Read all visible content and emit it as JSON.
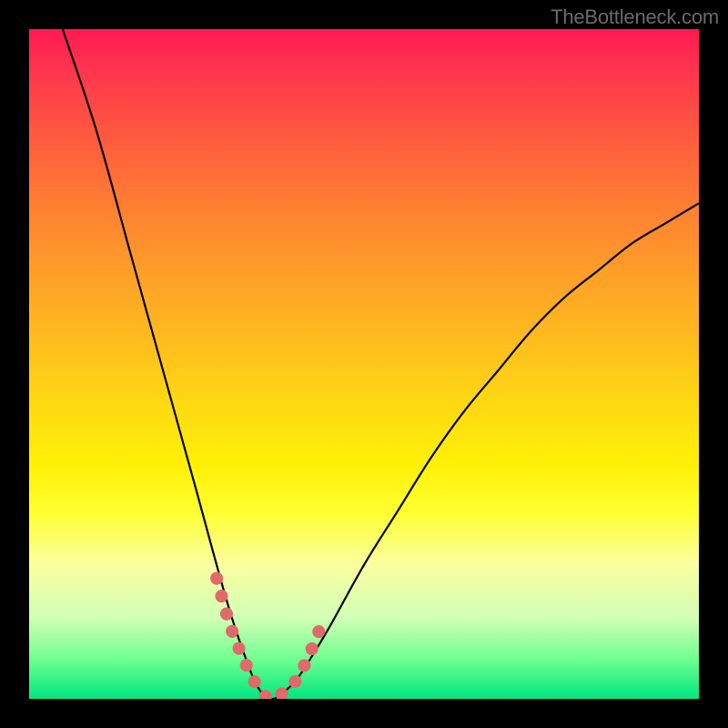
{
  "watermark_text": "TheBottleneck.com",
  "chart_data": {
    "type": "line",
    "title": "",
    "xlabel": "",
    "ylabel": "",
    "xlim": [
      0,
      100
    ],
    "ylim": [
      0,
      100
    ],
    "grid": false,
    "legend": false,
    "background_gradient": {
      "direction": "vertical",
      "note": "top (y=100) is red/bad, bottom (y=0) is green/good",
      "stops": [
        {
          "y": 100,
          "color": "#ff1a52"
        },
        {
          "y": 65,
          "color": "#ff9a2a"
        },
        {
          "y": 35,
          "color": "#fff007"
        },
        {
          "y": 12,
          "color": "#d0ffb5"
        },
        {
          "y": 0,
          "color": "#00e680"
        }
      ]
    },
    "series": [
      {
        "name": "bottleneck-curve",
        "interpretation": "V-shaped curve; minimum near x≈36 reaching y≈0",
        "x": [
          5,
          10,
          15,
          20,
          25,
          28,
          30,
          32,
          34,
          36,
          38,
          40,
          42,
          45,
          50,
          55,
          60,
          65,
          70,
          75,
          80,
          85,
          90,
          95,
          100
        ],
        "y": [
          100,
          85,
          67,
          49,
          31,
          20,
          13,
          7,
          2,
          0,
          1,
          3,
          6,
          11,
          20,
          28,
          36,
          43,
          49,
          55,
          60,
          64,
          68,
          71,
          74
        ]
      }
    ],
    "highlight": {
      "name": "recommended-range",
      "note": "dotted pink segment near trough",
      "x": [
        28,
        30,
        32,
        34,
        36,
        38,
        40,
        42,
        44
      ],
      "y": [
        18,
        11,
        6,
        2,
        0,
        1,
        3,
        7,
        12
      ]
    }
  }
}
